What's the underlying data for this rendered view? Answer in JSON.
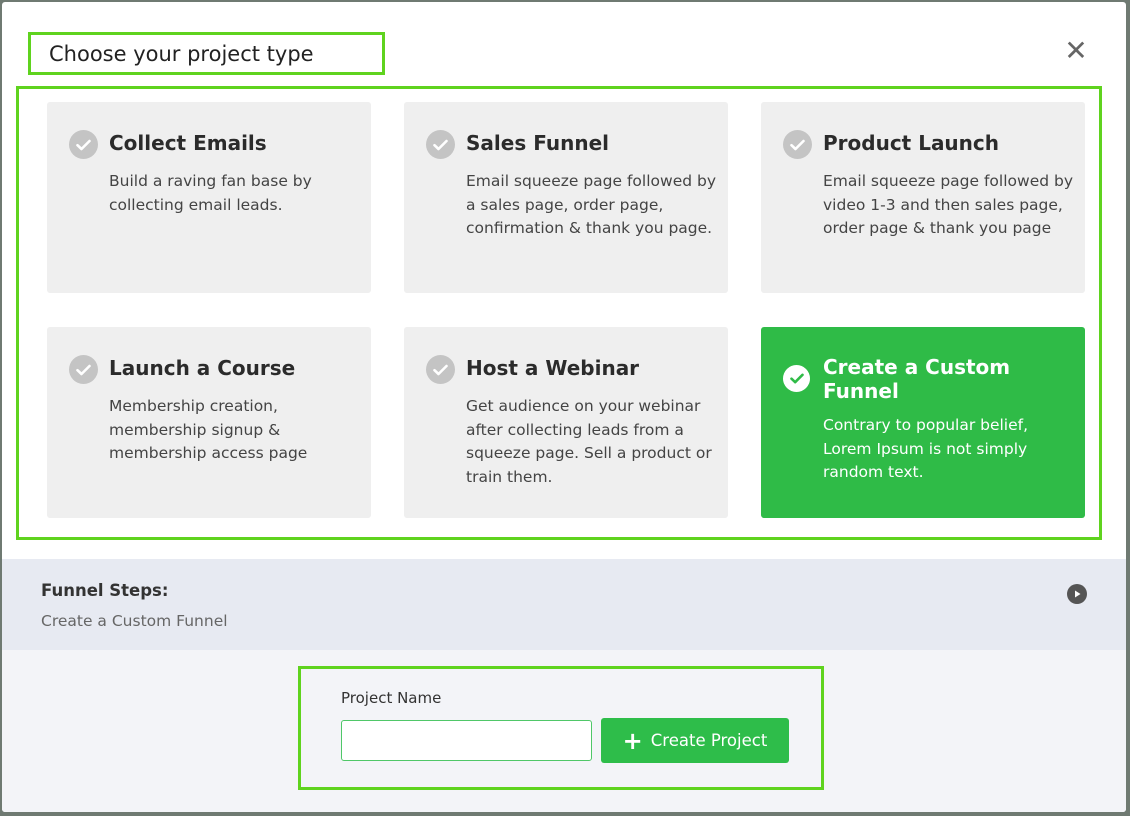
{
  "header": {
    "title": "Choose your project type",
    "close_icon": "close-icon"
  },
  "cards": [
    {
      "title": "Collect Emails",
      "desc": "Build a raving fan base by collecting email leads.",
      "selected": false
    },
    {
      "title": "Sales Funnel",
      "desc": "Email squeeze page followed by a sales page, order page, confirmation & thank you page.",
      "selected": false
    },
    {
      "title": "Product Launch",
      "desc": "Email squeeze page followed by video 1-3 and then sales page, order page & thank you page",
      "selected": false
    },
    {
      "title": "Launch a Course",
      "desc": "Membership creation, membership signup & membership access page",
      "selected": false
    },
    {
      "title": "Host a Webinar",
      "desc": "Get audience on your webinar after collecting leads from a squeeze page. Sell a product or train them.",
      "selected": false
    },
    {
      "title": "Create a Custom Funnel",
      "desc": "Contrary to popular belief, Lorem Ipsum is not simply random text.",
      "selected": true
    }
  ],
  "funnel_steps": {
    "title": "Funnel Steps:",
    "subtitle": "Create a Custom Funnel",
    "play_icon": "play-icon"
  },
  "form": {
    "label": "Project Name",
    "input_value": "",
    "input_placeholder": "",
    "button_label": "Create Project",
    "button_icon": "plus-icon"
  },
  "colors": {
    "accent_green": "#2fbb47",
    "highlight_outline": "#5fd31e",
    "card_bg": "#efefef",
    "check_gray": "#c4c4c4"
  }
}
